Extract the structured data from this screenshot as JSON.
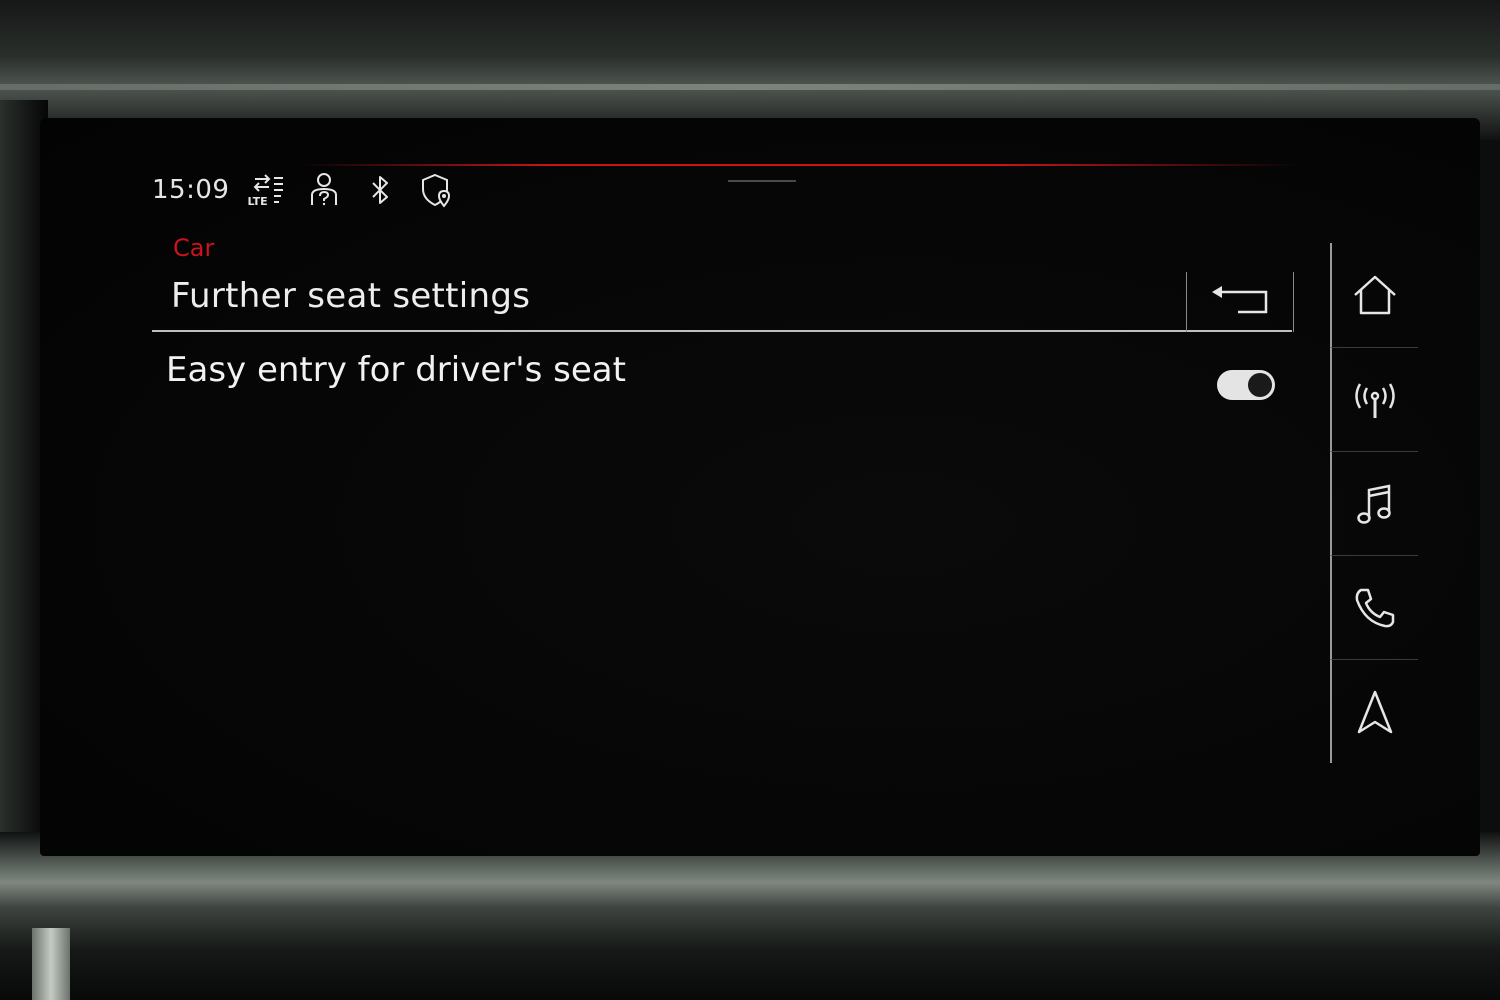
{
  "status_bar": {
    "time": "15:09",
    "network_label": "LTE",
    "icons": [
      "lte-data-icon",
      "user-profile-unknown-icon",
      "bluetooth-icon",
      "location-shield-icon"
    ]
  },
  "header": {
    "breadcrumb": "Car",
    "title": "Further seat settings",
    "back_icon": "back-arrow-icon"
  },
  "settings": {
    "items": [
      {
        "label": "Easy entry for driver's seat",
        "toggle_on": true
      }
    ]
  },
  "nav_rail": {
    "items": [
      {
        "icon": "home-icon"
      },
      {
        "icon": "radio-icon"
      },
      {
        "icon": "music-icon"
      },
      {
        "icon": "phone-icon"
      },
      {
        "icon": "navigation-icon"
      }
    ]
  },
  "colors": {
    "accent": "#c8151a",
    "text": "#ededed",
    "background": "#050505"
  }
}
